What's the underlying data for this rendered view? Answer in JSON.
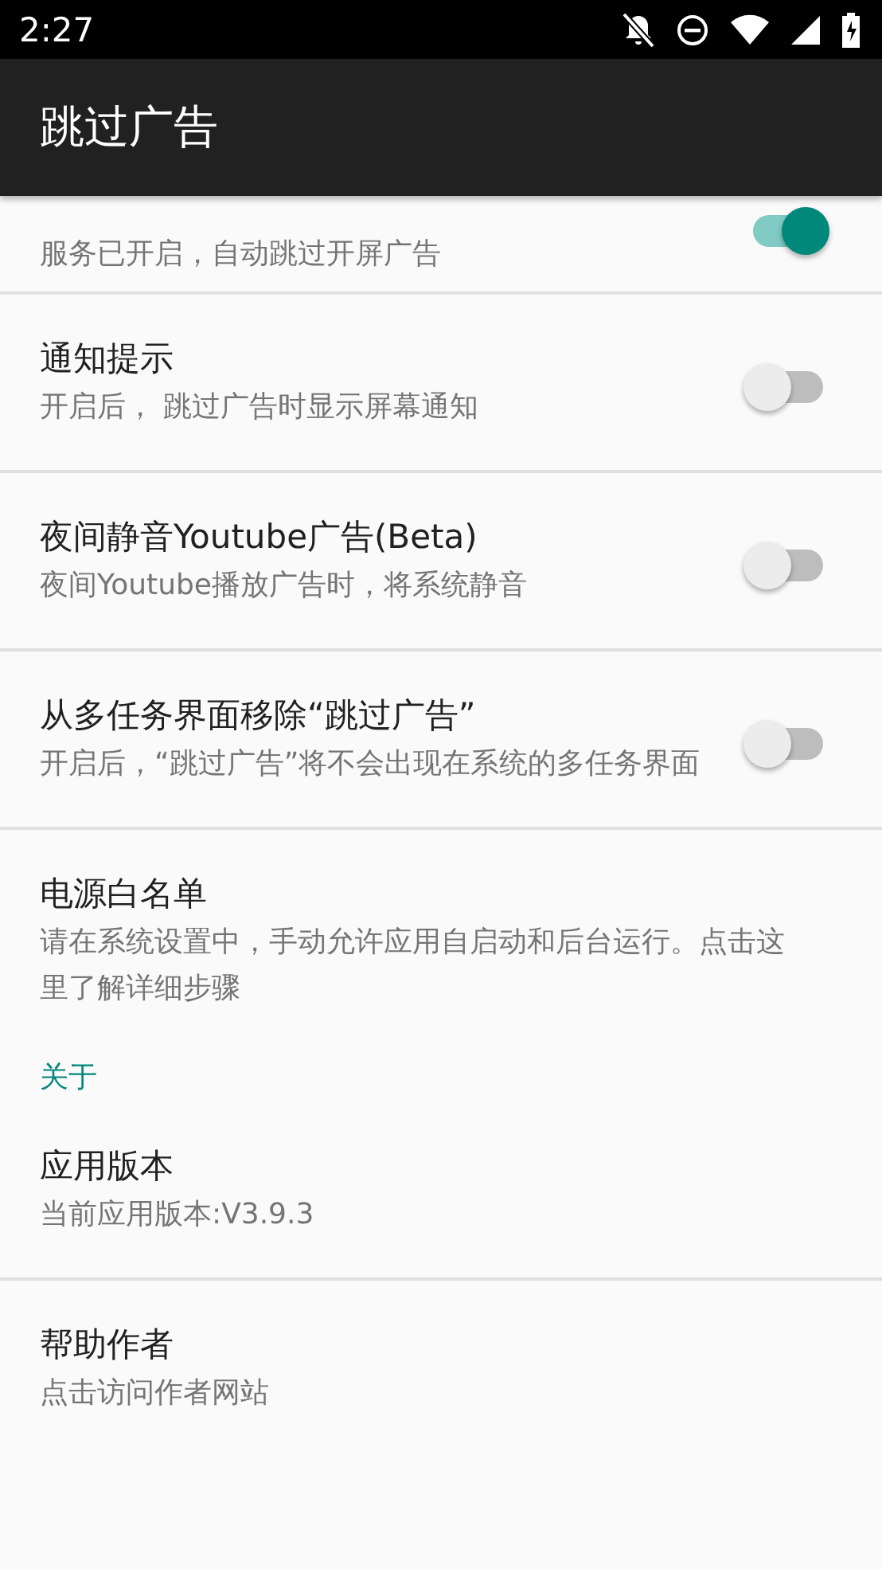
{
  "status_bar": {
    "time": "2:27"
  },
  "app_bar": {
    "title": "跳过广告"
  },
  "items": [
    {
      "kind": "switch",
      "summary": "服务已开启，自动跳过开屏广告",
      "on": true
    },
    {
      "kind": "switch",
      "title": "通知提示",
      "summary": "开启后， 跳过广告时显示屏幕通知",
      "on": false
    },
    {
      "kind": "switch",
      "title": "夜间静音Youtube广告(Beta)",
      "summary": "夜间Youtube播放广告时，将系统静音",
      "on": false
    },
    {
      "kind": "switch",
      "title": "从多任务界面移除“跳过广告”",
      "summary": "开启后，“跳过广告”将不会出现在系统的多任务界面",
      "on": false
    },
    {
      "kind": "plain",
      "title": "电源白名单",
      "summary": "请在系统设置中，手动允许应用自启动和后台运行。点击这里了解详细步骤",
      "divider": false
    },
    {
      "kind": "category",
      "title": "关于"
    },
    {
      "kind": "plain",
      "title": "应用版本",
      "summary": "当前应用版本:V3.9.3"
    },
    {
      "kind": "plain",
      "title": "帮助作者",
      "summary": "点击访问作者网站",
      "divider": false
    }
  ]
}
